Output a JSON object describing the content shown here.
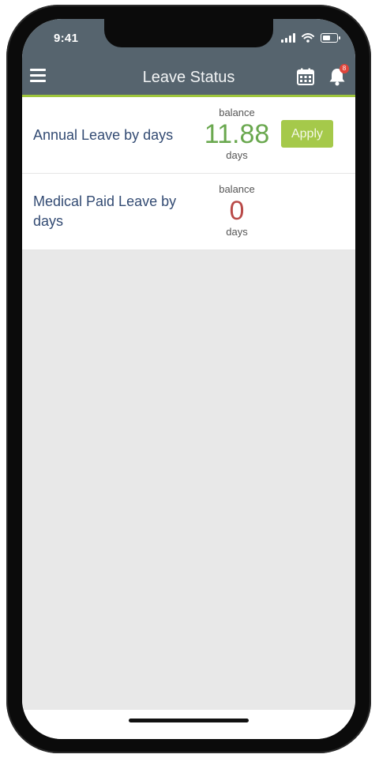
{
  "status_bar": {
    "time": "9:41",
    "icons": [
      "signal-icon",
      "wifi-icon",
      "battery-icon"
    ]
  },
  "header": {
    "title": "Leave Status",
    "menu_icon": "hamburger-menu-icon",
    "calendar_icon": "calendar-icon",
    "notification_icon": "bell-icon",
    "notification_count": "8"
  },
  "leaves": [
    {
      "name": "Annual Leave by days",
      "balance_label": "balance",
      "balance": "11.88",
      "unit": "days",
      "balance_color": "#6aa84f",
      "action_label": "Apply"
    },
    {
      "name": "Medical Paid Leave by days",
      "balance_label": "balance",
      "balance": "0",
      "unit": "days",
      "balance_color": "#b94a48"
    }
  ],
  "colors": {
    "header_bg": "#56646e",
    "accent": "#9fc63c",
    "apply_button": "#a5c94a",
    "label_text": "#334b73"
  }
}
